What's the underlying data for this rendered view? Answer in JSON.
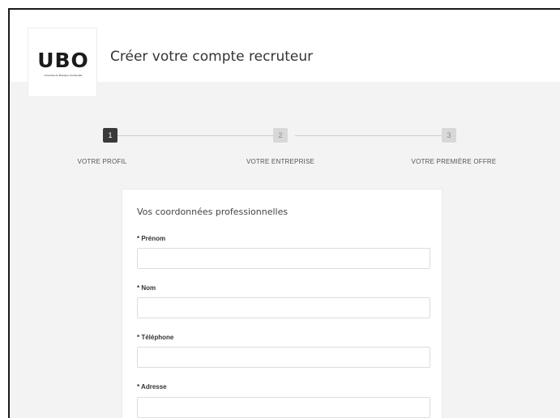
{
  "header": {
    "logo_mark": "UBO",
    "logo_sub": "Université de Bretagne Occidentale",
    "title": "Créer votre compte recruteur"
  },
  "stepper": {
    "current_step": 1,
    "steps": [
      {
        "number": "1",
        "label": "VOTRE PROFIL"
      },
      {
        "number": "2",
        "label": "VOTRE ENTREPRISE"
      },
      {
        "number": "3",
        "label": "VOTRE PREMIÈRE OFFRE"
      }
    ]
  },
  "form": {
    "section_title": "Vos coordonnées professionnelles",
    "fields": [
      {
        "label": "* Prénom",
        "value": ""
      },
      {
        "label": "* Nom",
        "value": ""
      },
      {
        "label": "* Téléphone",
        "value": ""
      },
      {
        "label": "* Adresse",
        "value": ""
      }
    ]
  },
  "colors": {
    "active_step": "#3a3a3a",
    "inactive_step": "#d8d8d8",
    "page_background": "#f3f3f3"
  }
}
